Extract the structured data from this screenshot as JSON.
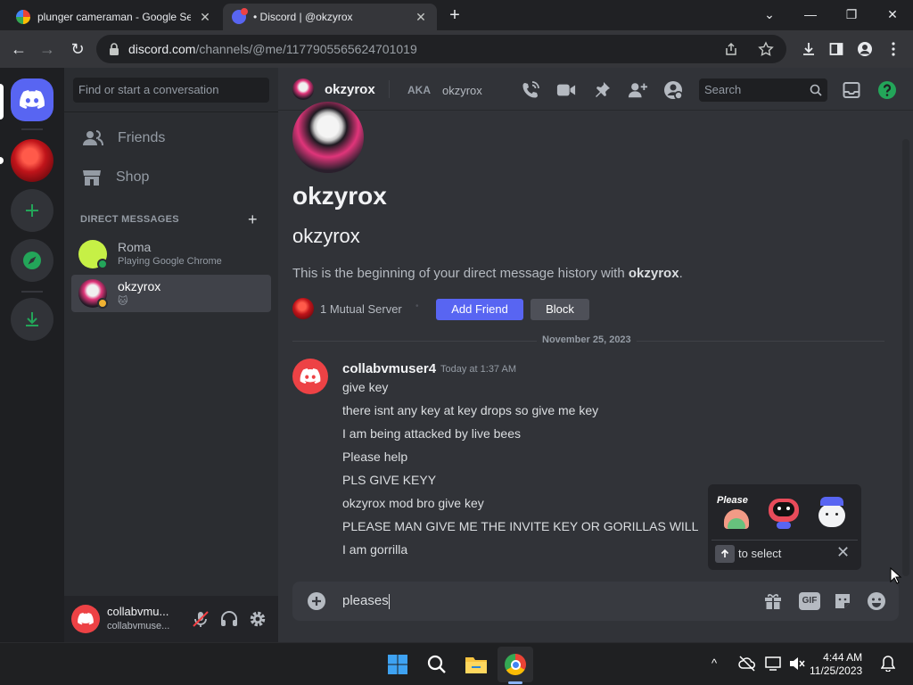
{
  "browser": {
    "tabs": [
      {
        "title": "plunger cameraman - Google Se",
        "close": "✕"
      },
      {
        "title": "• Discord | @okzyrox",
        "close": "✕"
      }
    ],
    "new_tab": "+",
    "url_host": "discord.com",
    "url_path": "/channels/@me/1177905565624701019"
  },
  "sidebar": {
    "search_placeholder": "Find or start a conversation",
    "nav": [
      {
        "label": "Friends"
      },
      {
        "label": "Shop"
      }
    ],
    "dm_header": "DIRECT MESSAGES",
    "dm_add": "+",
    "dms": [
      {
        "name": "Roma",
        "status": "Playing Google Chrome"
      },
      {
        "name": "okzyrox",
        "status": "🐱"
      }
    ],
    "user": {
      "name": "collabvmu...",
      "tag": "collabvmuse..."
    }
  },
  "header": {
    "name": "okzyrox",
    "aka_label": "AKA",
    "aka_name": "okzyrox",
    "search": "Search"
  },
  "profile": {
    "display_name": "okzyrox",
    "username": "okzyrox",
    "intro_prefix": "This is the beginning of your direct message history with ",
    "intro_name": "okzyrox",
    "intro_suffix": ".",
    "mutual": "1 Mutual Server",
    "sep": "•",
    "add_friend": "Add Friend",
    "block": "Block"
  },
  "divider_date": "November 25, 2023",
  "message": {
    "author": "collabvmuser4",
    "timestamp": "Today at 1:37 AM",
    "lines": [
      "give key",
      "there isnt any key at key drops so give me key",
      "I am being attacked by live bees",
      "Please help",
      "PLS GIVE KEYY",
      "okzyrox mod bro give key",
      "PLEASE MAN GIVE ME THE INVITE KEY OR GORILLAS WILL",
      "I am gorrilla"
    ]
  },
  "sticker_popup": {
    "sticker_text": "Please",
    "hint": "to select",
    "close": "✕"
  },
  "composer": {
    "value": "pleases",
    "gif": "GIF"
  },
  "taskbar": {
    "time": "4:44 AM",
    "date": "11/25/2023"
  },
  "colors": {
    "blurple": "#5865f2",
    "online": "#23a55a",
    "green": "#23a559",
    "bg_main": "#313338"
  }
}
